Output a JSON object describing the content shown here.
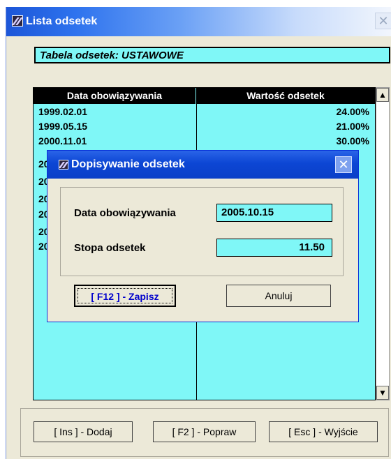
{
  "window": {
    "title": "Lista odsetek",
    "close_glyph": "✕"
  },
  "header": {
    "text": "Tabela odsetek: USTAWOWE"
  },
  "table": {
    "columns": [
      "Data obowiązywania",
      "Wartość odsetek"
    ],
    "rows": [
      {
        "date": "1999.02.01",
        "value": "24.00%"
      },
      {
        "date": "1999.05.15",
        "value": "21.00%"
      },
      {
        "date": "2000.11.01",
        "value": "30.00%"
      },
      {
        "date": "20",
        "value": ""
      },
      {
        "date": "20",
        "value": ""
      },
      {
        "date": "20",
        "value": ""
      },
      {
        "date": "20",
        "value": ""
      },
      {
        "date": "20",
        "value": ""
      },
      {
        "date": "20",
        "value": ""
      }
    ]
  },
  "scrollbar": {
    "up_glyph": "▲",
    "down_glyph": "▼"
  },
  "buttons": {
    "add": "[ Ins ] - Dodaj",
    "edit": "[ F2 ] - Popraw",
    "exit": "[ Esc ] - Wyjście"
  },
  "dialog": {
    "title": "Dopisywanie odsetek",
    "close_glyph": "✕",
    "date_label": "Data obowiązywania",
    "date_value": "2005.10.15",
    "rate_label": "Stopa odsetek",
    "rate_value": "11.50",
    "save_label": "[ F12 ] - Zapisz",
    "cancel_label": "Anuluj"
  },
  "colors": {
    "cyan": "#7ff7f7",
    "title_blue": "#0c46d4",
    "face": "#ece9d8"
  }
}
